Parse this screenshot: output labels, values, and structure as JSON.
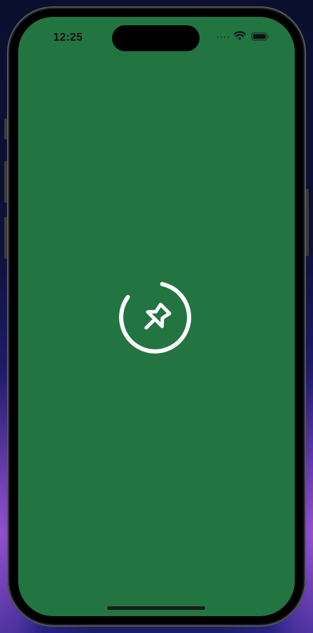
{
  "status_bar": {
    "time": "12:25",
    "signal_icon": "cellular-signal-icon",
    "wifi_icon": "wifi-icon",
    "battery_icon": "battery-icon"
  },
  "splash": {
    "icon": "pin-icon",
    "indicator": "loading-spinner",
    "background_color": "#227441",
    "icon_color": "#ffffff"
  }
}
